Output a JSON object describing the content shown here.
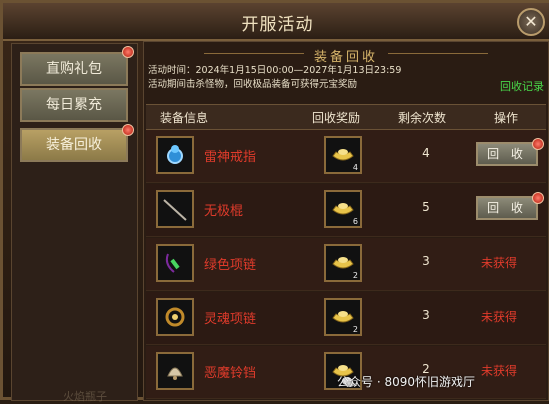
{
  "window": {
    "title": "开服活动",
    "close_glyph": "✕"
  },
  "left_menu": {
    "items": [
      {
        "label": "直购礼包",
        "badge": true,
        "active": false
      },
      {
        "label": "每日累充",
        "badge": false,
        "active": false
      },
      {
        "label": "装备回收",
        "badge": true,
        "active": true
      }
    ],
    "watermark": "火焰瓶子"
  },
  "panel": {
    "title": "装备回收",
    "time_text": "活动时间：2024年1月15日00:00—2027年1月13日23:59",
    "desc_text": "活动期间击杀怪物，回收极品装备可获得元宝奖励",
    "record_link": "回收记录"
  },
  "table": {
    "headers": [
      "装备信息",
      "回收奖励",
      "剩余次数",
      "操作"
    ],
    "rows": [
      {
        "name": "雷神戒指",
        "reward_icon": "gold-ingot-icon",
        "reward_count": "4",
        "times": "4",
        "action": "回 收",
        "action_type": "button",
        "item_icon": "ring-icon"
      },
      {
        "name": "无极棍",
        "reward_icon": "gold-ingot-icon",
        "reward_count": "6",
        "times": "5",
        "action": "回 收",
        "action_type": "button",
        "item_icon": "staff-icon"
      },
      {
        "name": "绿色项链",
        "reward_icon": "gold-ingot-icon",
        "reward_count": "2",
        "times": "3",
        "action": "未获得",
        "action_type": "text",
        "item_icon": "necklace-icon"
      },
      {
        "name": "灵魂项链",
        "reward_icon": "gold-ingot-icon",
        "reward_count": "2",
        "times": "3",
        "action": "未获得",
        "action_type": "text",
        "item_icon": "necklace-icon"
      },
      {
        "name": "恶魔铃铛",
        "reward_icon": "gold-ingot-icon",
        "reward_count": "2",
        "times": "2",
        "action": "未获得",
        "action_type": "text",
        "item_icon": "bell-icon"
      }
    ]
  },
  "overlay": {
    "wechat_text": "公众号 · 8090怀旧游戏厅"
  },
  "colors": {
    "accent_red": "#e03b2b",
    "accent_green": "#49d84a",
    "title_gold": "#d6b46a"
  }
}
